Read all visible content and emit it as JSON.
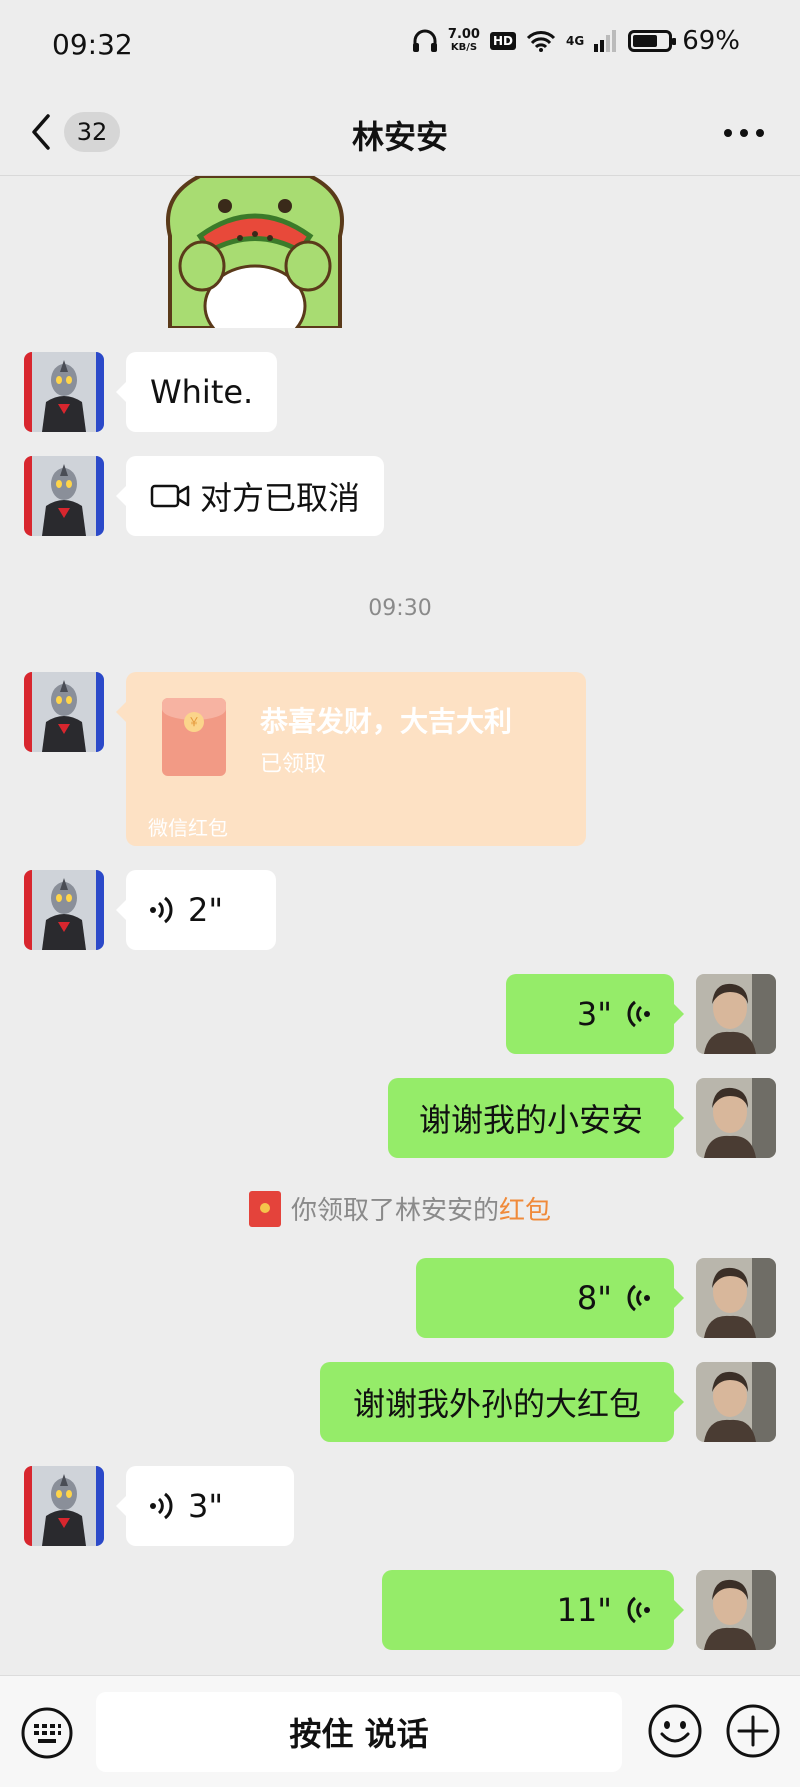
{
  "status_bar": {
    "time": "09:32",
    "net_speed_value": "7.00",
    "net_speed_unit": "KB/S",
    "hd_label": "HD",
    "signal_label": "4G",
    "battery": "69%",
    "battery_level": 0.69
  },
  "nav": {
    "unread_count": "32",
    "title": "林安安"
  },
  "messages": {
    "m1": {
      "text": "White."
    },
    "m2": {
      "text": "对方已取消",
      "icon": "video-camera-icon"
    },
    "time1": "09:30",
    "red_packet": {
      "title": "恭喜发财，大吉大利",
      "status": "已领取",
      "footer": "微信红包",
      "coin": "￥"
    },
    "m4": {
      "duration": "2\""
    },
    "m5": {
      "duration": "3\""
    },
    "m6": {
      "text": "谢谢我的小安安"
    },
    "system": {
      "prefix": "你领取了林安安的",
      "link": "红包"
    },
    "m7": {
      "duration": "8\""
    },
    "m8": {
      "text": "谢谢我外孙的大红包"
    },
    "m9": {
      "duration": "3\""
    },
    "m10": {
      "duration": "11\""
    }
  },
  "input_bar": {
    "hold_to_talk": "按住 说话"
  },
  "colors": {
    "background": "#ededed",
    "sent_bubble": "#95ec69",
    "received_bubble": "#ffffff",
    "red_packet_received": "#fde1c4",
    "link_orange": "#f08a3a"
  }
}
